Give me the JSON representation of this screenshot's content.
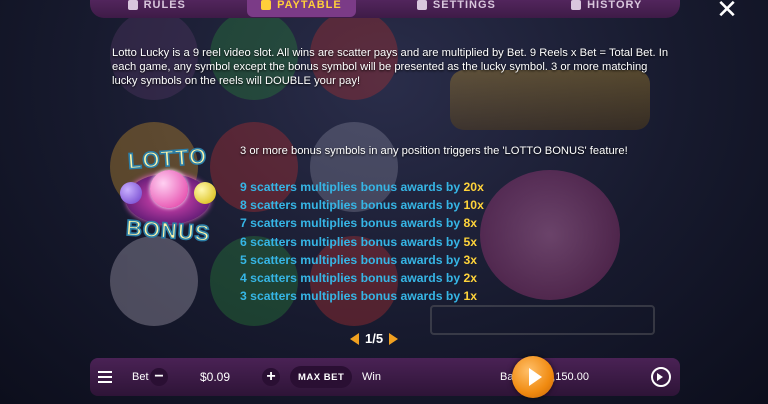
{
  "tabs": [
    {
      "label": "RULES",
      "icon": "book-icon"
    },
    {
      "label": "PAYTABLE",
      "icon": "clover-icon",
      "active": true
    },
    {
      "label": "SETTINGS",
      "icon": "gear-icon"
    },
    {
      "label": "HISTORY",
      "icon": "clock-icon"
    }
  ],
  "intro_text": "Lotto Lucky is a 9 reel video slot. All wins are scatter pays and are multiplied by Bet. 9 Reels x Bet = Total Bet. In each game, any symbol except the bonus symbol will be presented as the lucky symbol. 3 or more matching lucky symbols on the reels will DOUBLE your pay!",
  "bonus_logo": {
    "line1": "LOTTO",
    "line2": "BONUS"
  },
  "trigger_text": "3 or more bonus symbols in any position triggers the 'LOTTO BONUS' feature!",
  "scatter_rows": [
    {
      "text": "9 scatters multiplies bonus awards by ",
      "mult": "20x"
    },
    {
      "text": "8 scatters multiplies bonus awards by ",
      "mult": "10x"
    },
    {
      "text": "7 scatters multiplies bonus awards by ",
      "mult": "8x"
    },
    {
      "text": "6 scatters multiplies bonus awards by ",
      "mult": "5x"
    },
    {
      "text": "5 scatters multiplies bonus awards by ",
      "mult": "3x"
    },
    {
      "text": "4 scatters multiplies bonus awards by ",
      "mult": "2x"
    },
    {
      "text": "3 scatters multiplies bonus awards by ",
      "mult": "1x"
    }
  ],
  "pager": {
    "text": "1/5"
  },
  "bottom": {
    "bet_label": "Bet",
    "minus": "−",
    "bet_value": "$0.09",
    "plus": "+",
    "max_bet": "MAX BET",
    "win_label": "Win",
    "balance_label": "Balance",
    "balance_value": "$1,150.00"
  },
  "colors": {
    "accent": "#ffd33a",
    "scatter_text": "#36b6e6",
    "spin_button": "#f08a10",
    "bar_bg": "#4a2255"
  }
}
